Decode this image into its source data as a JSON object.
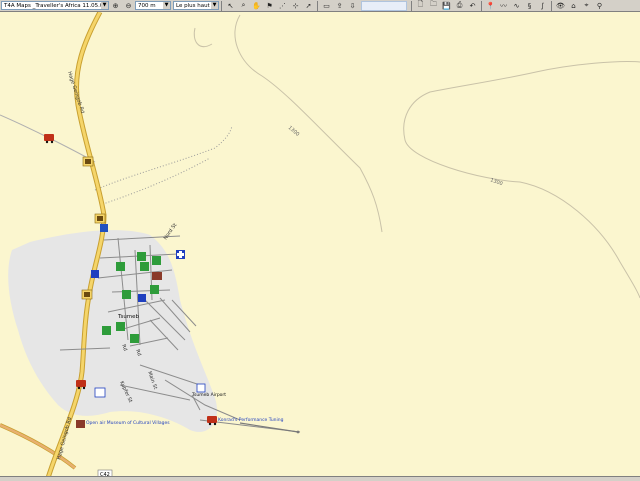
{
  "toolbar": {
    "map_product": "T4A Maps _Traveller's Africa 11.05.01",
    "zoom_scale": "700 m",
    "detail_level": "Le plus haut",
    "zoom_in_icon": "zoom-in-icon",
    "zoom_out_icon": "zoom-out-icon"
  },
  "map": {
    "contours": [
      "1300",
      "1300"
    ],
    "road_badge": "C42",
    "poi_labels": {
      "museum": "Open air Museum of Cultural Villages",
      "conrad": "Konrad's Performance Tuning",
      "airport": "Tsumeb Airport",
      "town": "Tsumeb"
    },
    "street_labels": {
      "main_st": "Main St",
      "kopfer_st": "Kupfer St",
      "nord_st": "Nord St",
      "rd1": "Rd",
      "rd2": "Rd",
      "hage_road": "Hage Geingob Rd",
      "hage_north": "Hage Geingob Rd"
    }
  },
  "colors": {
    "background": "#FBF6CF",
    "urban": "#E6E6E6",
    "highway_fill": "#F5D56A",
    "highway_edge": "#C8A030",
    "main_road": "#E8B070",
    "contour": "#C9C2A8",
    "street": "#8C8C8C"
  }
}
